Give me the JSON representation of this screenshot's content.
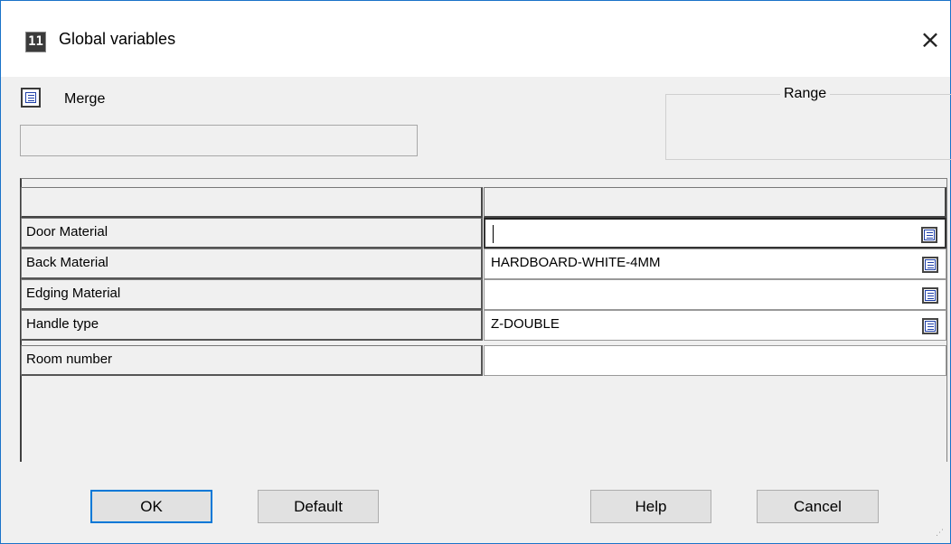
{
  "window": {
    "title": "Global variables",
    "app_icon_text": "11",
    "close_glyph": "×"
  },
  "merge": {
    "label": "Merge",
    "field_value": "",
    "icon": "list-icon"
  },
  "range": {
    "label": "Range"
  },
  "grid": {
    "header": [
      "",
      ""
    ],
    "rows": [
      {
        "name": "Door Material",
        "value": "",
        "has_picker": true,
        "active": true
      },
      {
        "name": "Back Material",
        "value": "HARDBOARD-WHITE-4MM",
        "has_picker": true,
        "active": false
      },
      {
        "name": "Edging Material",
        "value": "",
        "has_picker": true,
        "active": false
      },
      {
        "name": "Handle type",
        "value": "Z-DOUBLE",
        "has_picker": true,
        "active": false
      },
      {
        "name": "Room number",
        "value": "",
        "has_picker": false,
        "active": false
      }
    ]
  },
  "buttons": {
    "ok": "OK",
    "default": "Default",
    "help": "Help",
    "cancel": "Cancel"
  },
  "colors": {
    "window_border": "#1a73c9",
    "focus_border": "#0078d7",
    "icon_blue": "#1e3fa8"
  }
}
